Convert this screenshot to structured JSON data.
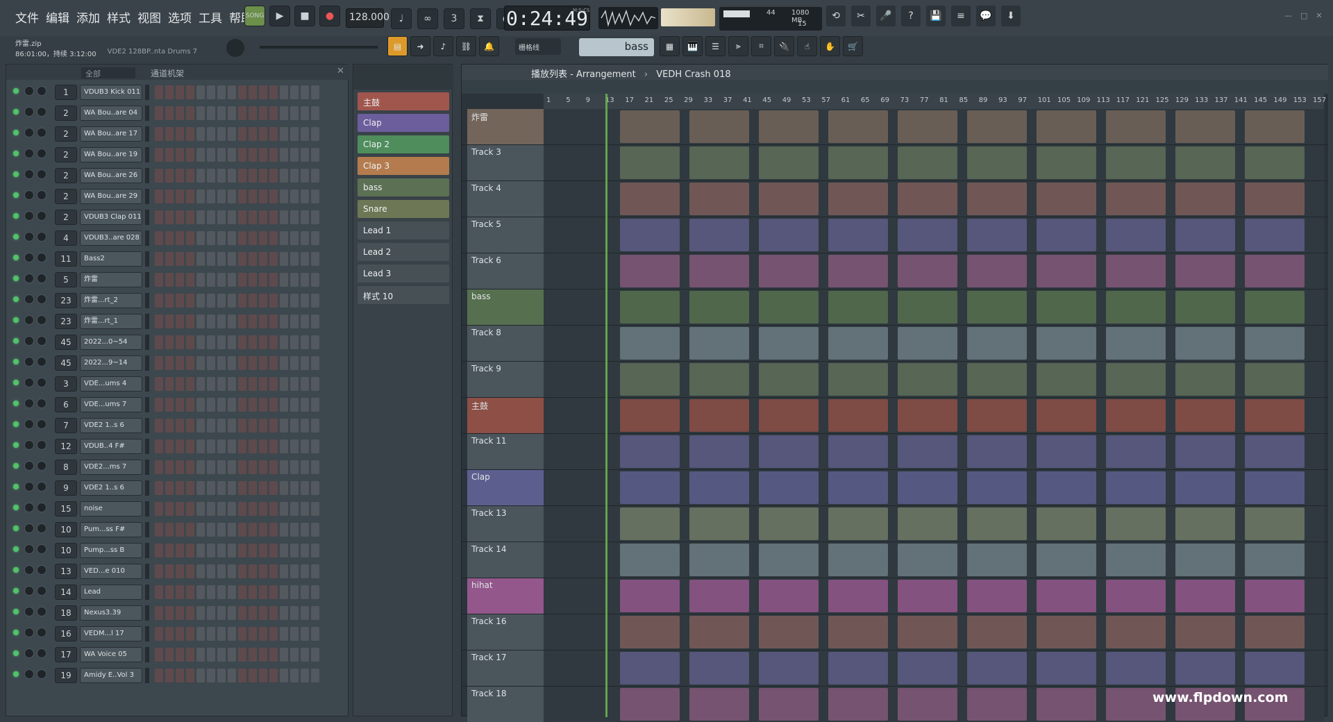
{
  "menu": [
    "文件",
    "编辑",
    "添加",
    "样式",
    "视图",
    "选项",
    "工具",
    "帮助"
  ],
  "transport": {
    "song_label": "SONG",
    "tempo": "128.000",
    "time": "0:24:49",
    "time_unit": "M:S:CS",
    "mem_value": "44",
    "mem_total": "1080 MB",
    "mem_poly": "15"
  },
  "hint": {
    "file": "炸雷.zip",
    "info": "86:01:00，持续 3:12:00",
    "plugin": "VDE2 128BP..nta Drums 7"
  },
  "toolbar": {
    "snap": "栅格线",
    "pattern": "bass"
  },
  "rack": {
    "title": "通道机架",
    "filter": "全部"
  },
  "channels": [
    {
      "num": "1",
      "name": "VDUB3 Kick 011",
      "type": "sample"
    },
    {
      "num": "2",
      "name": "WA Bou..are 04",
      "type": "sample"
    },
    {
      "num": "2",
      "name": "WA Bou..are 17",
      "type": "sample"
    },
    {
      "num": "2",
      "name": "WA Bou..are 19",
      "type": "sample"
    },
    {
      "num": "2",
      "name": "WA Bou..are 26",
      "type": "sample"
    },
    {
      "num": "2",
      "name": "WA Bou..are 29",
      "type": "sample"
    },
    {
      "num": "2",
      "name": "VDUB3 Clap 011",
      "type": "sample"
    },
    {
      "num": "4",
      "name": "VDUB3..are 028",
      "type": "sample"
    },
    {
      "num": "11",
      "name": "Bass2",
      "type": "synth"
    },
    {
      "num": "5",
      "name": "炸雷",
      "type": "audio"
    },
    {
      "num": "23",
      "name": "炸雷...rt_2",
      "type": "audio"
    },
    {
      "num": "23",
      "name": "炸雷...rt_1",
      "type": "audio"
    },
    {
      "num": "45",
      "name": "2022...0~54",
      "type": "audio"
    },
    {
      "num": "45",
      "name": "2022...9~14",
      "type": "audio"
    },
    {
      "num": "3",
      "name": "VDE...ums 4",
      "type": "audio"
    },
    {
      "num": "6",
      "name": "VDE...ums 7",
      "type": "audio"
    },
    {
      "num": "7",
      "name": "VDE2 1..s 6",
      "type": "audio"
    },
    {
      "num": "12",
      "name": "VDUB..4 F#",
      "type": "audio"
    },
    {
      "num": "8",
      "name": "VDE2...ms 7",
      "type": "audio"
    },
    {
      "num": "9",
      "name": "VDE2 1..s 6",
      "type": "audio"
    },
    {
      "num": "15",
      "name": "noise",
      "type": "audio"
    },
    {
      "num": "10",
      "name": "Pum...ss F#",
      "type": "audio"
    },
    {
      "num": "10",
      "name": "Pump...ss B",
      "type": "audio"
    },
    {
      "num": "13",
      "name": "VED...e 010",
      "type": "audio"
    },
    {
      "num": "14",
      "name": "Lead",
      "type": "synth"
    },
    {
      "num": "18",
      "name": "Nexus3.39",
      "type": "synth"
    },
    {
      "num": "16",
      "name": "VEDM...l 17",
      "type": "audio"
    },
    {
      "num": "17",
      "name": "WA Voice 05",
      "type": "audio"
    },
    {
      "num": "19",
      "name": "Amidy E..Vol 3",
      "type": "synth"
    }
  ],
  "patterns": [
    {
      "name": "主鼓",
      "color": "#a1564d"
    },
    {
      "name": "Clap",
      "color": "#6c5e9c"
    },
    {
      "name": "Clap 2",
      "color": "#4f8d5c"
    },
    {
      "name": "Clap 3",
      "color": "#b47c4e"
    },
    {
      "name": "bass",
      "color": "#5c7054"
    },
    {
      "name": "Snare",
      "color": "#6d7756"
    },
    {
      "name": "Lead 1",
      "color": "#465055"
    },
    {
      "name": "Lead 2",
      "color": "#465055"
    },
    {
      "name": "Lead 3",
      "color": "#465055"
    },
    {
      "name": "样式 10",
      "color": "#465055"
    }
  ],
  "playlist": {
    "title": "播放列表 - Arrangement",
    "song": "VEDH Crash 018"
  },
  "ruler": [
    "1",
    "5",
    "9",
    "13",
    "17",
    "21",
    "25",
    "29",
    "33",
    "37",
    "41",
    "45",
    "49",
    "53",
    "57",
    "61",
    "65",
    "69",
    "73",
    "77",
    "81",
    "85",
    "89",
    "93",
    "97",
    "101",
    "105",
    "109",
    "113",
    "117",
    "121",
    "125",
    "129",
    "133",
    "137",
    "141",
    "145",
    "149",
    "153",
    "157"
  ],
  "tracks": [
    {
      "name": "炸雷",
      "color": "#73655a"
    },
    {
      "name": "Track 3",
      "color": ""
    },
    {
      "name": "Track 4",
      "color": ""
    },
    {
      "name": "Track 5",
      "color": ""
    },
    {
      "name": "Track 6",
      "color": ""
    },
    {
      "name": "bass",
      "color": "#56704f"
    },
    {
      "name": "Track 8",
      "color": ""
    },
    {
      "name": "Track 9",
      "color": ""
    },
    {
      "name": "主鼓",
      "color": "#8d4f46"
    },
    {
      "name": "Track 11",
      "color": ""
    },
    {
      "name": "Clap",
      "color": "#5c5f8e"
    },
    {
      "name": "Track 13",
      "color": ""
    },
    {
      "name": "Track 14",
      "color": ""
    },
    {
      "name": "hihat",
      "color": "#93578b"
    },
    {
      "name": "Track 16",
      "color": ""
    },
    {
      "name": "Track 17",
      "color": ""
    },
    {
      "name": "Track 18",
      "color": ""
    }
  ],
  "watermark": "www.flpdown.com"
}
